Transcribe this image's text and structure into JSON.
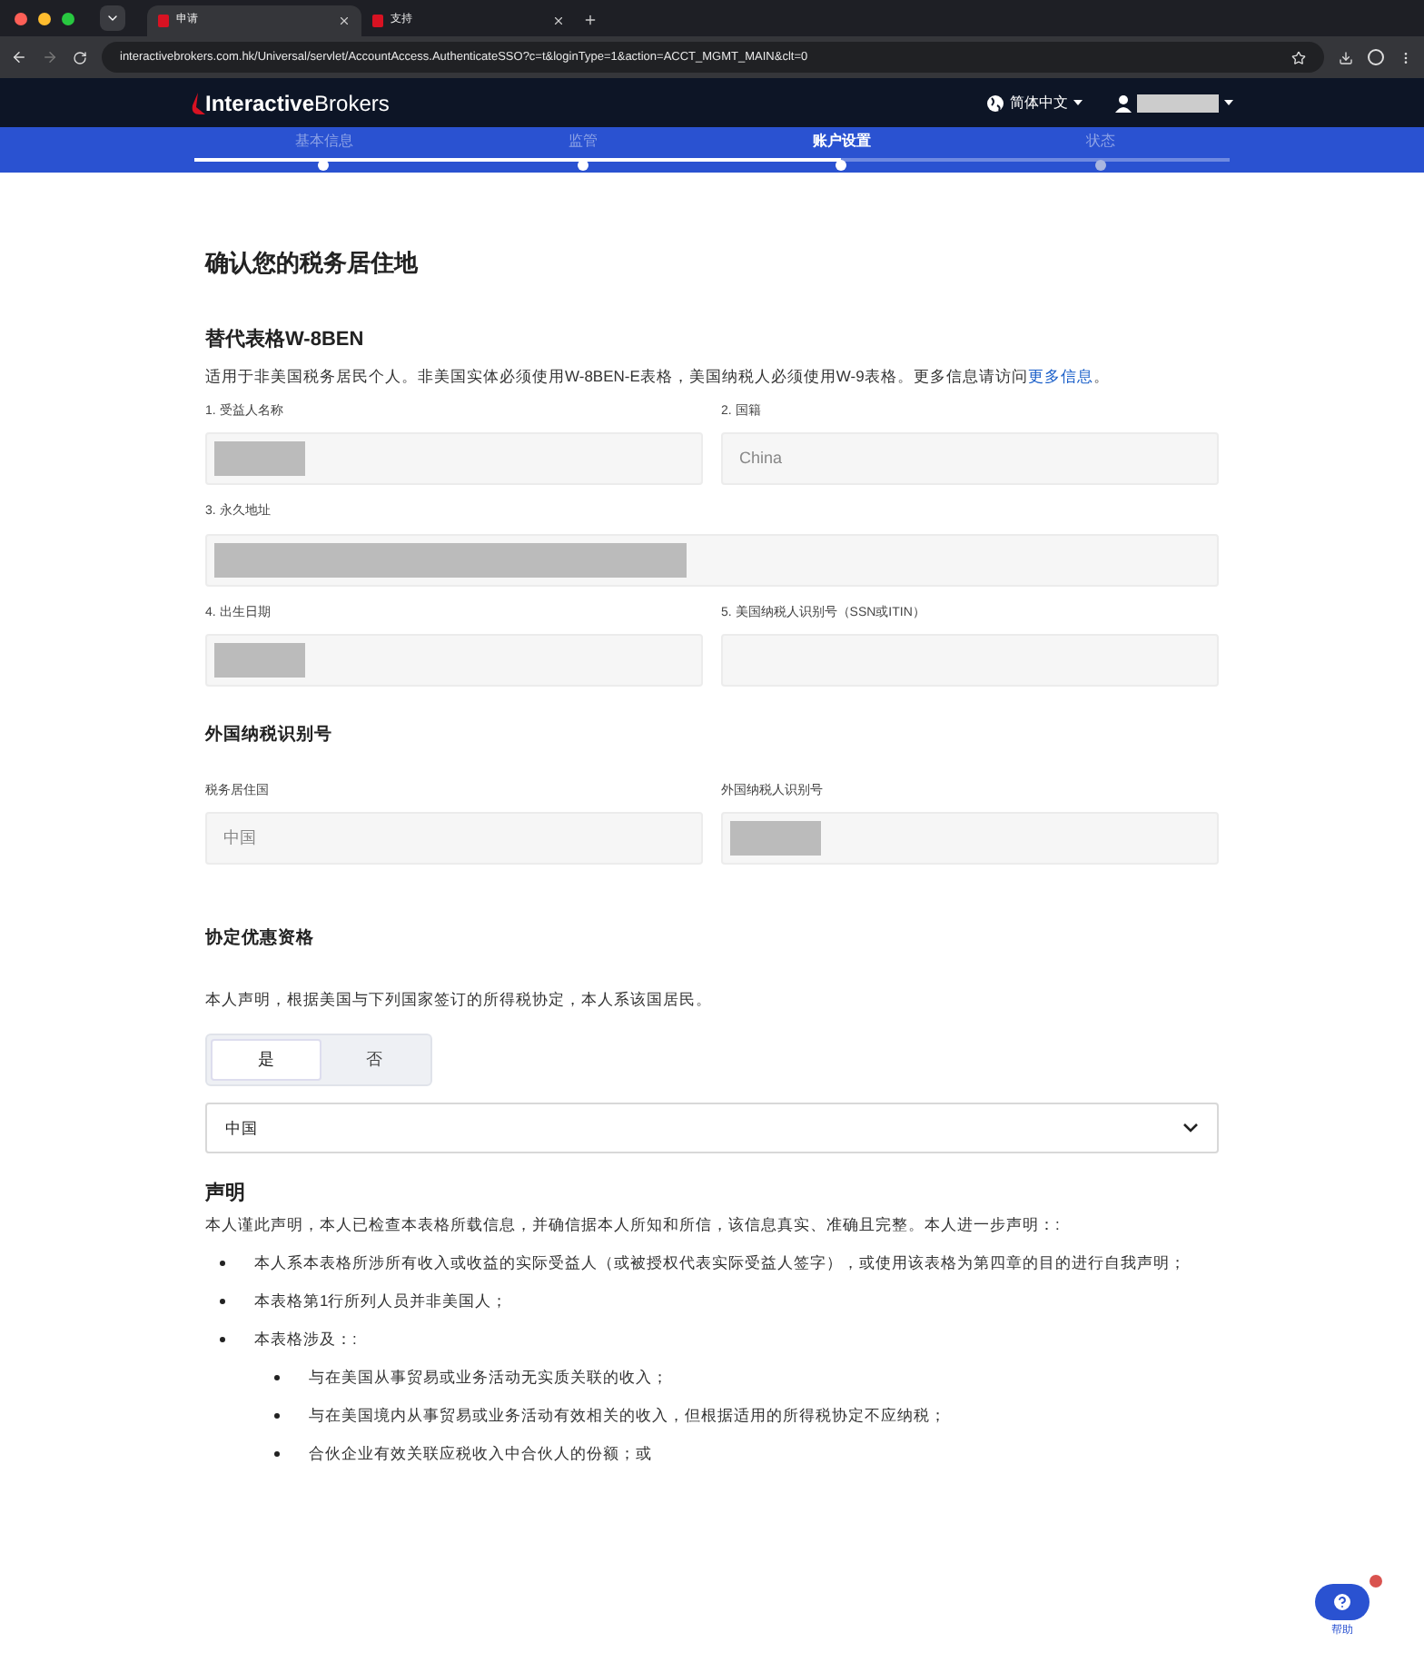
{
  "browser": {
    "tabs": [
      {
        "label": "申请",
        "selected": true
      },
      {
        "label": "支持",
        "selected": false
      }
    ],
    "url": "interactivebrokers.com.hk/Universal/servlet/AccountAccess.AuthenticateSSO?c=t&loginType=1&action=ACCT_MGMT_MAIN&clt=0"
  },
  "header": {
    "logo_bold": "Interactive",
    "logo_light": "Brokers",
    "language": "简体中文"
  },
  "steps": [
    {
      "label": "基本信息",
      "selected": false
    },
    {
      "label": "监管",
      "selected": false
    },
    {
      "label": "账户设置",
      "selected": true
    },
    {
      "label": "状态",
      "selected": false
    }
  ],
  "page_title": "确认您的税务居住地",
  "w8ben": {
    "title": "替代表格W-8BEN",
    "intro": "适用于非美国税务居民个人。非美国实体必须使用W-8BEN-E表格，美国纳税人必须使用W-9表格。更多信息请访问",
    "link": "更多信息",
    "intro_end": "。",
    "fields": [
      {
        "label": "1. 受益人名称",
        "kind": "redacted",
        "wide": false
      },
      {
        "label": "2. 国籍",
        "kind": "text",
        "value": "China",
        "wide": false
      },
      {
        "label": "3. 永久地址",
        "kind": "redacted",
        "wide": true
      },
      {
        "label": "4. 出生日期",
        "kind": "redacted",
        "wide": false
      },
      {
        "label": "5. 美国纳税人识别号（SSN或ITIN）",
        "kind": "empty",
        "wide": false
      }
    ]
  },
  "foreign_tin": {
    "title": "外国纳税识别号",
    "fields": [
      {
        "label": "税务居住国",
        "kind": "text",
        "value": "中国",
        "wide": false
      },
      {
        "label": "外国纳税人识别号",
        "kind": "redacted",
        "wide": false
      }
    ]
  },
  "treaty": {
    "title": "协定优惠资格",
    "statement": "本人声明，根据美国与下列国家签订的所得税协定，本人系该国居民。",
    "options": [
      {
        "label": "是",
        "selected": true
      },
      {
        "label": "否",
        "selected": false
      }
    ],
    "country": "中国"
  },
  "declaration": {
    "title": "声明",
    "intro": "本人谨此声明，本人已检查本表格所载信息，并确信据本人所知和所信，该信息真实、准确且完整。本人进一步声明：:",
    "items": [
      {
        "text": "本人系本表格所涉所有收入或收益的实际受益人（或被授权代表实际受益人签字），或使用该表格为第四章的目的进行自我声明；"
      },
      {
        "text": "本表格第1行所列人员并非美国人；"
      },
      {
        "text": "本表格涉及：:",
        "children": [
          {
            "text": "与在美国从事贸易或业务活动无实质关联的收入；"
          },
          {
            "text": "与在美国境内从事贸易或业务活动有效相关的收入，但根据适用的所得税协定不应纳税；"
          },
          {
            "text": "合伙企业有效关联应税收入中合伙人的份额；或"
          }
        ]
      }
    ]
  },
  "help": {
    "label": "帮助",
    "notification": true
  }
}
